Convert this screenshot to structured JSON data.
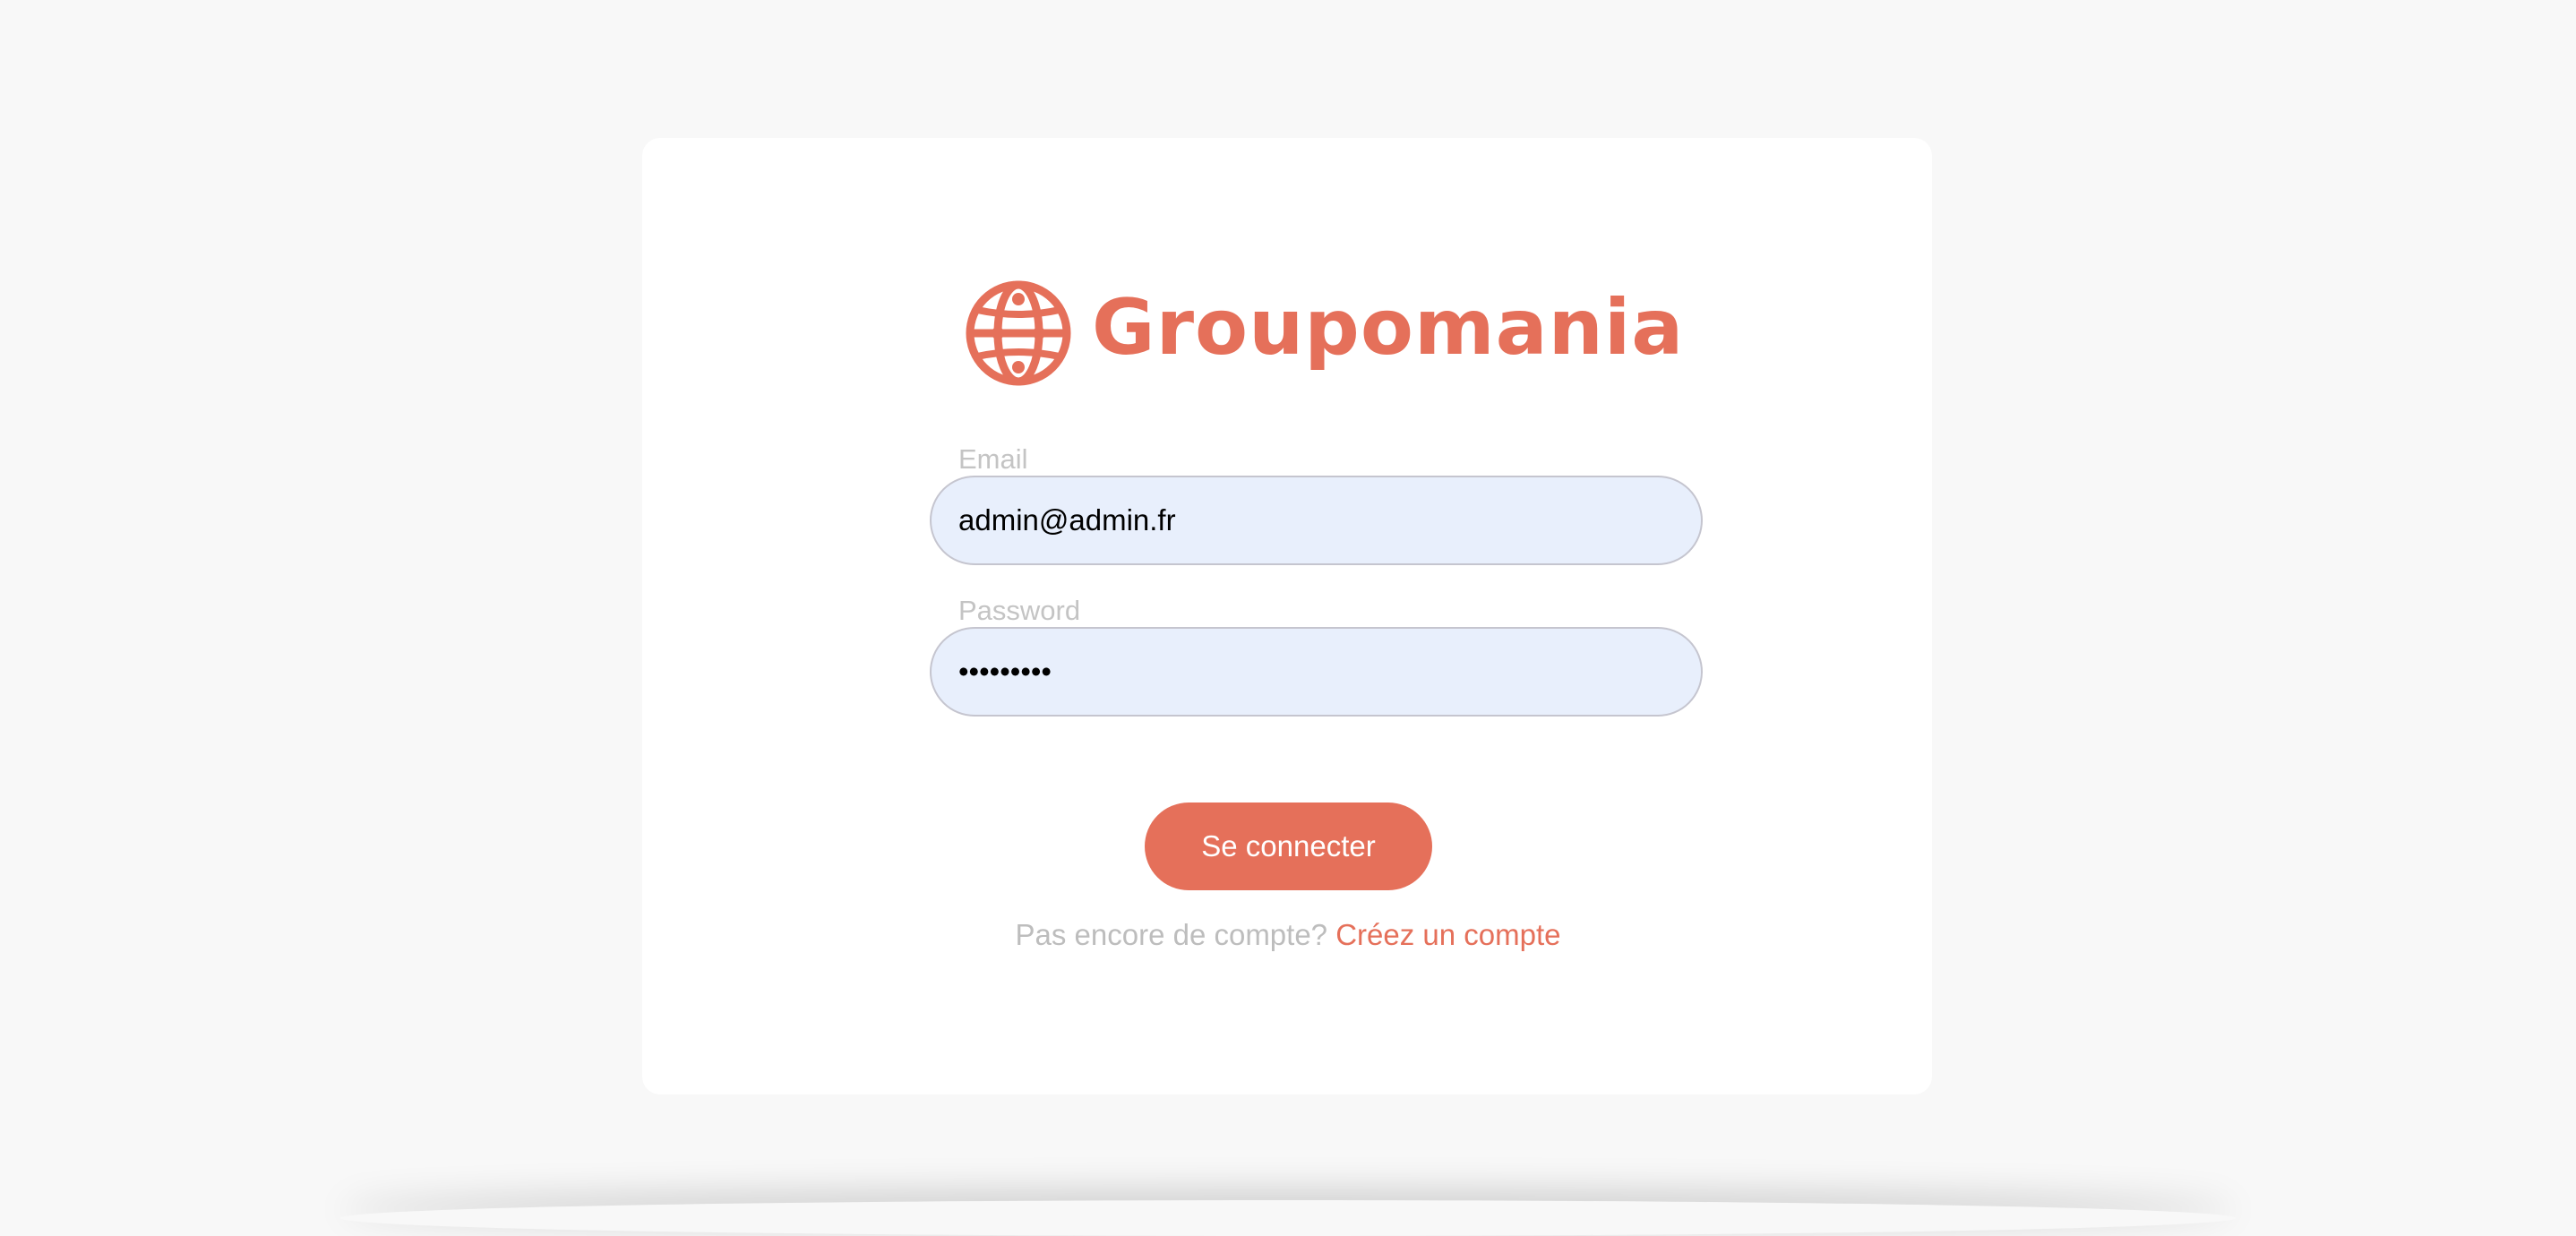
{
  "brand": {
    "name": "Groupomania",
    "color": "#e5705a",
    "icon": "globe-icon"
  },
  "login_form": {
    "email_label": "Email",
    "email_value": "admin@admin.fr",
    "password_label": "Password",
    "password_value": "•••••••••",
    "submit_label": "Se connecter",
    "signup_prompt": "Pas encore de compte?",
    "signup_link": "Créez un compte"
  },
  "colors": {
    "accent": "#e5705a",
    "input_background": "#e8effc",
    "page_background": "#f8f8f8",
    "card_background": "#ffffff",
    "muted_text": "#c4c4c4"
  }
}
